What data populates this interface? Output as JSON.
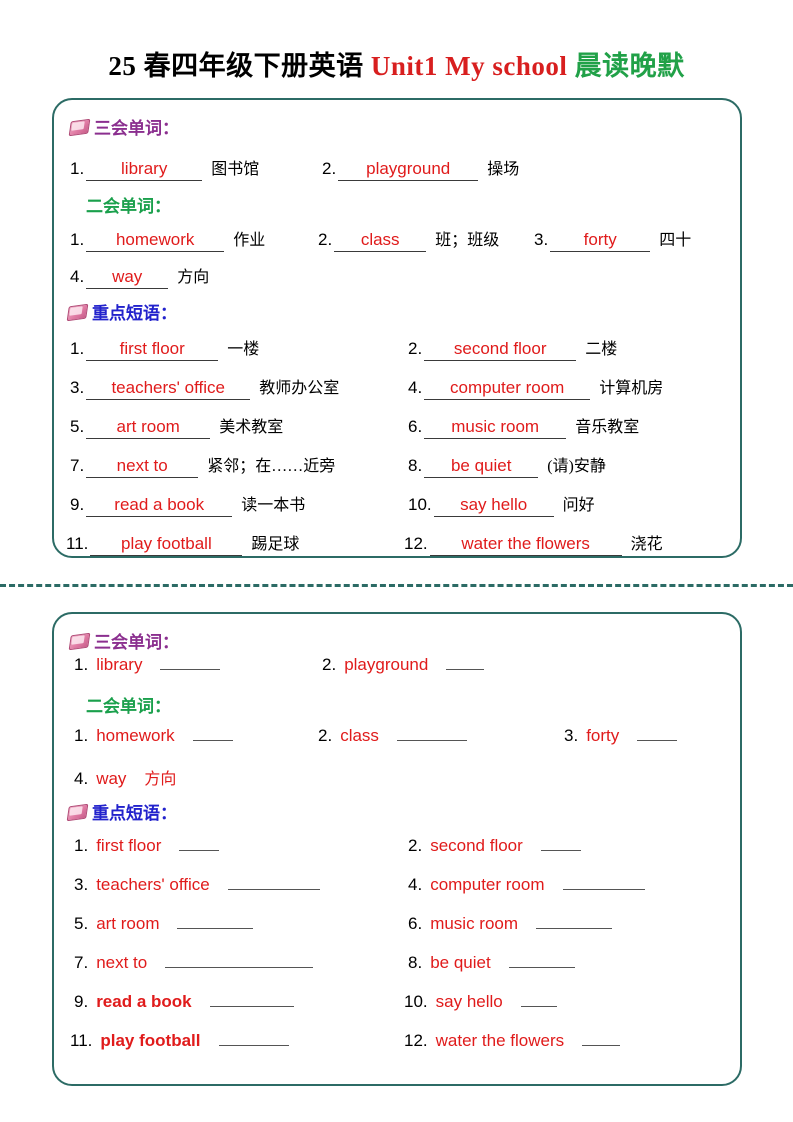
{
  "title": {
    "black": "25 春四年级下册英语 ",
    "red": "Unit1 My school ",
    "green": "晨读晚默"
  },
  "sections": {
    "three_skill": "三会单词：",
    "two_skill": "二会单词：",
    "key_phrases": "重点短语："
  },
  "icons": {
    "book": "book-icon"
  },
  "answers_card": {
    "three_skill_words": [
      {
        "no": "1.",
        "en": "library",
        "cn": "图书馆"
      },
      {
        "no": "2.",
        "en": "playground",
        "cn": "操场"
      }
    ],
    "two_skill_words": [
      {
        "no": "1.",
        "en": "homework",
        "cn": "作业"
      },
      {
        "no": "2.",
        "en": "class",
        "cn": "班；班级"
      },
      {
        "no": "3.",
        "en": "forty",
        "cn": "四十"
      },
      {
        "no": "4.",
        "en": "way",
        "cn": "方向"
      }
    ],
    "phrases": [
      {
        "no": "1.",
        "en": "first floor",
        "cn": "一楼"
      },
      {
        "no": "2.",
        "en": "second floor",
        "cn": "二楼"
      },
      {
        "no": "3.",
        "en": "teachers' office",
        "cn": "教师办公室"
      },
      {
        "no": "4.",
        "en": "computer room",
        "cn": "计算机房"
      },
      {
        "no": "5.",
        "en": "art room",
        "cn": "美术教室"
      },
      {
        "no": "6.",
        "en": "music room",
        "cn": "音乐教室"
      },
      {
        "no": "7.",
        "en": "next to",
        "cn": "紧邻；在……近旁"
      },
      {
        "no": "8.",
        "en": "be quiet",
        "cn": "(请)安静"
      },
      {
        "no": "9.",
        "en": "read a book",
        "cn": "读一本书"
      },
      {
        "no": "10.",
        "en": "say hello",
        "cn": "问好"
      },
      {
        "no": "11.",
        "en": "play football",
        "cn": "踢足球"
      },
      {
        "no": "12.",
        "en": "water the flowers",
        "cn": "浇花"
      }
    ]
  },
  "blanks_card": {
    "three_skill_words": [
      {
        "no": "1.",
        "en": "library",
        "cn": ""
      },
      {
        "no": "2.",
        "en": "playground",
        "cn": ""
      }
    ],
    "two_skill_words": [
      {
        "no": "1.",
        "en": "homework",
        "cn": ""
      },
      {
        "no": "2.",
        "en": "class",
        "cn": ""
      },
      {
        "no": "3.",
        "en": "forty",
        "cn": ""
      },
      {
        "no": "4.",
        "en": "way",
        "cn": "方向"
      }
    ],
    "phrases": [
      {
        "no": "1.",
        "en": "first floor",
        "cn": ""
      },
      {
        "no": "2.",
        "en": "second floor",
        "cn": ""
      },
      {
        "no": "3.",
        "en": "teachers' office",
        "cn": ""
      },
      {
        "no": "4.",
        "en": "computer room",
        "cn": ""
      },
      {
        "no": "5.",
        "en": "art room",
        "cn": ""
      },
      {
        "no": "6.",
        "en": "music room",
        "cn": ""
      },
      {
        "no": "7.",
        "en": "next to",
        "cn": ""
      },
      {
        "no": "8.",
        "en": "be quiet",
        "cn": ""
      },
      {
        "no": "9.",
        "en": "read a book",
        "cn": ""
      },
      {
        "no": "10.",
        "en": "say hello",
        "cn": ""
      },
      {
        "no": "11.",
        "en": "play football",
        "cn": ""
      },
      {
        "no": "12.",
        "en": "water the flowers",
        "cn": ""
      }
    ]
  },
  "colors": {
    "card_border": "#2c6b65",
    "answer_red": "#e01b1b",
    "title_red": "#d81f1f",
    "title_green": "#21a148",
    "heading_purple": "#8b2f8f",
    "heading_green": "#1aa04c",
    "heading_blue": "#2222cc"
  }
}
